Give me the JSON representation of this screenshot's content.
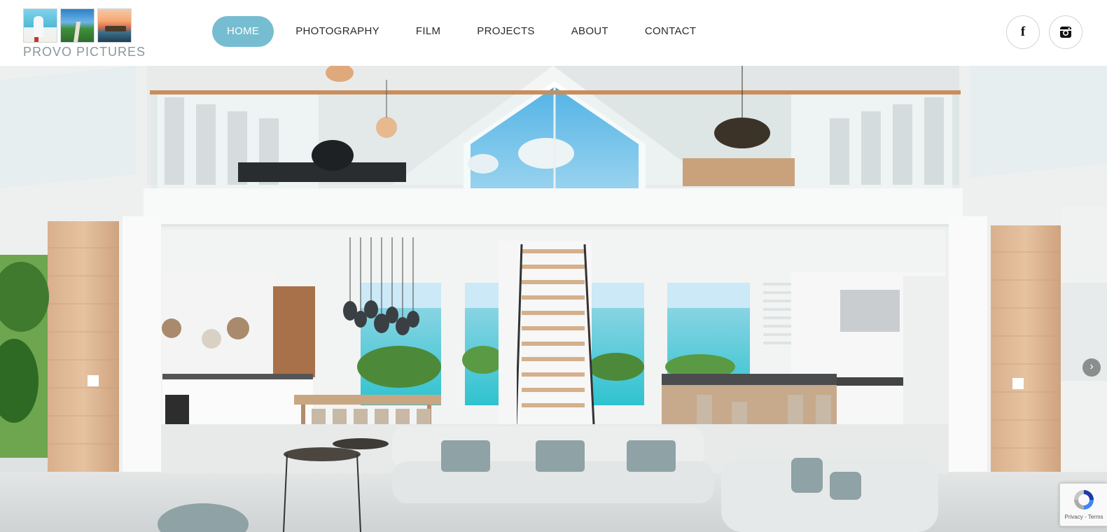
{
  "brand": {
    "name": "PROVO PICTURES",
    "logo_tiles": [
      "beach-woman-photo",
      "garden-path-photo",
      "sunset-pool-photo"
    ]
  },
  "nav": {
    "items": [
      {
        "label": "HOME",
        "active": true
      },
      {
        "label": "PHOTOGRAPHY",
        "active": false
      },
      {
        "label": "FILM",
        "active": false
      },
      {
        "label": "PROJECTS",
        "active": false
      },
      {
        "label": "ABOUT",
        "active": false
      },
      {
        "label": "CONTACT",
        "active": false
      }
    ],
    "active_color": "#76bdd1"
  },
  "social": {
    "facebook_icon": "facebook-icon",
    "facebook_glyph": "f",
    "instagram_icon": "instagram-icon"
  },
  "hero": {
    "image": "luxury-villa-open-plan-interior-photo",
    "next_arrow": "›"
  },
  "recaptcha": {
    "icon": "recaptcha-icon",
    "links": "Privacy - Terms"
  }
}
